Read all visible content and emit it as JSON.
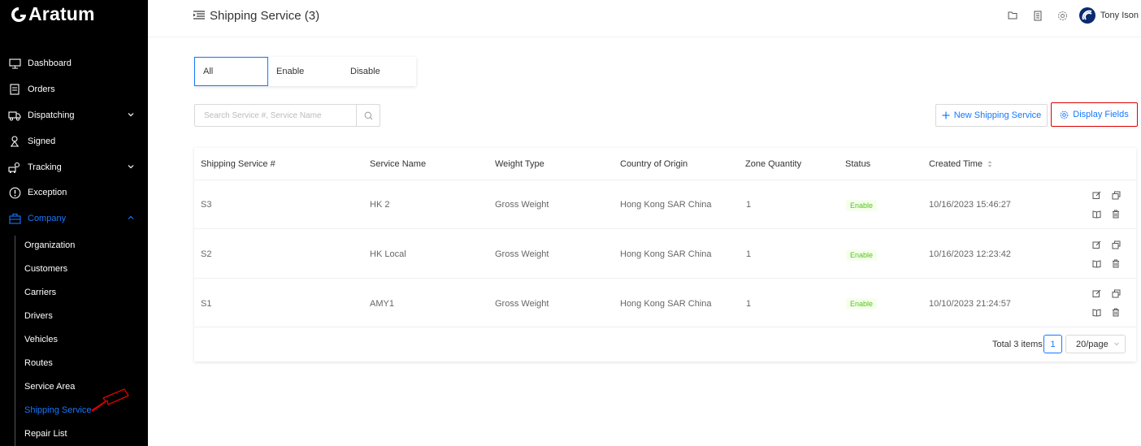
{
  "app": {
    "logo_text": "Aratum"
  },
  "sidebar": {
    "items": [
      {
        "label": "Dashboard",
        "icon": "monitor-icon"
      },
      {
        "label": "Orders",
        "icon": "orders-icon"
      },
      {
        "label": "Dispatching",
        "icon": "truck-icon",
        "expandable": true
      },
      {
        "label": "Signed",
        "icon": "signature-icon"
      },
      {
        "label": "Tracking",
        "icon": "tracking-icon",
        "expandable": true
      },
      {
        "label": "Exception",
        "icon": "exclamation-icon"
      },
      {
        "label": "Company",
        "icon": "company-icon",
        "expandable": true,
        "expanded": true,
        "active": true
      }
    ],
    "company_subitems": [
      {
        "label": "Organization"
      },
      {
        "label": "Customers"
      },
      {
        "label": "Carriers"
      },
      {
        "label": "Drivers"
      },
      {
        "label": "Vehicles"
      },
      {
        "label": "Routes"
      },
      {
        "label": "Service Area"
      },
      {
        "label": "Shipping Service",
        "active": true
      },
      {
        "label": "Repair List"
      }
    ]
  },
  "header": {
    "title": "Shipping Service (3)",
    "icons": [
      "folder-icon",
      "document-icon",
      "settings-icon"
    ],
    "user_name": "Tony Ison"
  },
  "filter_tabs": [
    {
      "label": "All",
      "active": true
    },
    {
      "label": "Enable"
    },
    {
      "label": "Disable"
    }
  ],
  "search": {
    "placeholder": "Search Service #, Service Name",
    "value": ""
  },
  "toolbar": {
    "new_label": "New Shipping Service",
    "fields_label": "Display Fields"
  },
  "table": {
    "columns": [
      "Shipping Service #",
      "Service Name",
      "Weight Type",
      "Country of Origin",
      "Zone Quantity",
      "Status",
      "Created Time"
    ],
    "rows": [
      {
        "id": "S3",
        "name": "HK 2",
        "weight_type": "Gross Weight",
        "origin": "Hong Kong SAR China",
        "zones": "1",
        "status": "Enable",
        "created": "10/16/2023 15:46:27"
      },
      {
        "id": "S2",
        "name": "HK Local",
        "weight_type": "Gross Weight",
        "origin": "Hong Kong SAR China",
        "zones": "1",
        "status": "Enable",
        "created": "10/16/2023 12:23:42"
      },
      {
        "id": "S1",
        "name": "AMY1",
        "weight_type": "Gross Weight",
        "origin": "Hong Kong SAR China",
        "zones": "1",
        "status": "Enable",
        "created": "10/10/2023 21:24:57"
      }
    ]
  },
  "pagination": {
    "total_text": "Total 3 items",
    "current_page": "1",
    "page_size": "20/page"
  },
  "colors": {
    "accent": "#1677ff",
    "status_green": "#52c41a",
    "sidebar_bg": "#000000",
    "annotation_red": "#dd0000"
  }
}
